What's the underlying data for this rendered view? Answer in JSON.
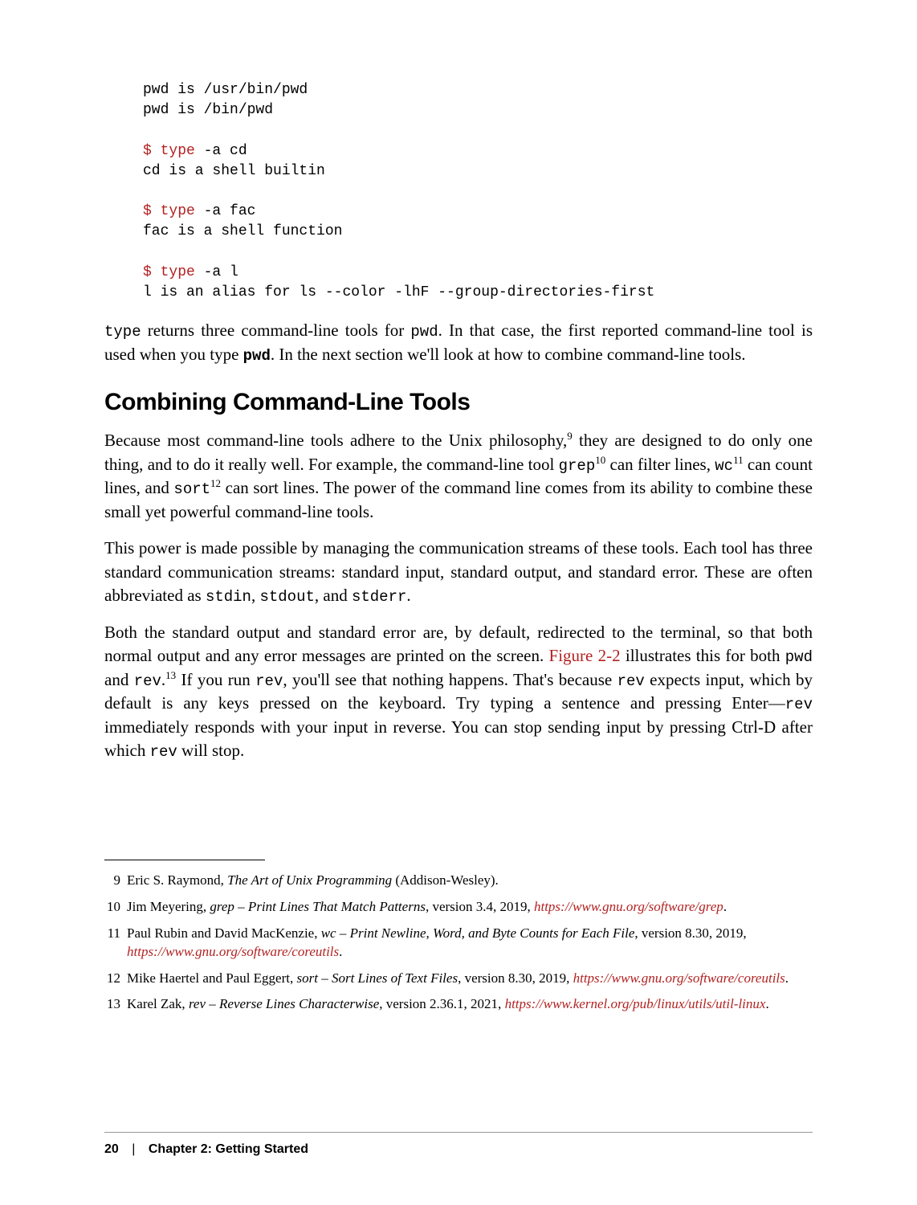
{
  "code": {
    "line1": "pwd is /usr/bin/pwd",
    "line2": "pwd is /bin/pwd",
    "prompt1": "$ ",
    "cmd1": "type",
    "args1": " -a cd",
    "out1": "cd is a shell builtin",
    "prompt2": "$ ",
    "cmd2": "type",
    "args2": " -a fac",
    "out2": "fac is a shell function",
    "prompt3": "$ ",
    "cmd3": "type",
    "args3": " -a l",
    "out3": "l is an alias for ls --color -lhF --group-directories-first"
  },
  "para1": {
    "pre": "",
    "mono1": "type",
    "mid1": " returns three command-line tools for ",
    "mono2": "pwd",
    "mid2": ". In that case, the first reported command-line tool is used when you type ",
    "mono3": "pwd",
    "mid3": ". In the next section we'll look at how to combine command-line tools."
  },
  "heading": "Combining Command-Line Tools",
  "para2": {
    "t1": "Because most command-line tools adhere to the Unix philosophy,",
    "sup1": "9",
    "t2": " they are designed to do only one thing, and to do it really well. For example, the command-line tool ",
    "mono1": "grep",
    "sup2": "10",
    "t3": " can filter lines, ",
    "mono2": "wc",
    "sup3": "11",
    "t4": " can count lines, and ",
    "mono3": "sort",
    "sup4": "12",
    "t5": " can sort lines. The power of the command line comes from its ability to combine these small yet powerful command-line tools."
  },
  "para3": {
    "t1": "This power is made possible by managing the communication streams of these tools. Each tool has three standard communication streams: standard input, standard output, and standard error. These are often abbreviated as ",
    "mono1": "stdin",
    "t2": ", ",
    "mono2": "stdout",
    "t3": ", and ",
    "mono3": "stderr",
    "t4": "."
  },
  "para4": {
    "t1": "Both the standard output and standard error are, by default, redirected to the terminal, so that both normal output and any error messages are printed on the screen. ",
    "link1": "Figure 2-2",
    "t2": " illustrates this for both ",
    "mono1": "pwd",
    "t3": " and ",
    "mono2": "rev",
    "t4": ".",
    "sup1": "13",
    "t5": " If you run ",
    "mono3": "rev",
    "t6": ", you'll see that nothing happens. That's because ",
    "mono4": "rev",
    "t7": " expects input, which by default is any keys pressed on the keyboard. Try typing a sentence and pressing Enter—",
    "mono5": "rev",
    "t8": " immediately responds with your input in reverse. You can stop sending input by pressing Ctrl-D after which ",
    "mono6": "rev",
    "t9": " will stop."
  },
  "footnotes": [
    {
      "num": "9",
      "author": "Eric S. Raymond, ",
      "title": "The Art of Unix Programming",
      "rest": " (Addison-Wesley)."
    },
    {
      "num": "10",
      "author": "Jim Meyering, ",
      "title": "grep – Print Lines That Match Patterns",
      "rest": ", version 3.4, 2019, ",
      "link": "https://www.gnu.org/software/grep",
      "end": "."
    },
    {
      "num": "11",
      "author": "Paul Rubin and David MacKenzie, ",
      "title": "wc – Print Newline, Word, and Byte Counts for Each File",
      "rest": ", version 8.30, 2019, ",
      "link": "https://www.gnu.org/software/coreutils",
      "end": "."
    },
    {
      "num": "12",
      "author": "Mike Haertel and Paul Eggert, ",
      "title": "sort – Sort Lines of Text Files",
      "rest": ", version 8.30, 2019, ",
      "link": "https://www.gnu.org/software/coreutils",
      "end": "."
    },
    {
      "num": "13",
      "author": "Karel Zak, ",
      "title": "rev – Reverse Lines Characterwise",
      "rest": ", version 2.36.1, 2021, ",
      "link": "https://www.kernel.org/pub/linux/utils/util-linux",
      "end": "."
    }
  ],
  "footer": {
    "page": "20",
    "divider": "|",
    "chapter": "Chapter 2: Getting Started"
  }
}
